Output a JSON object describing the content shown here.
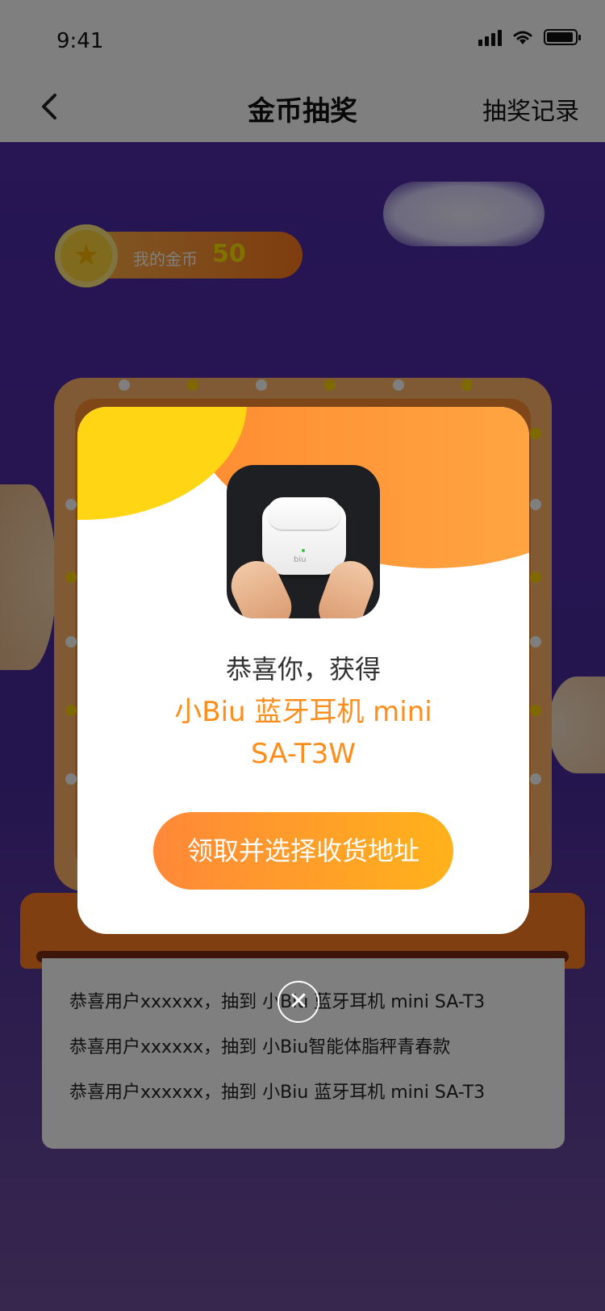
{
  "status": {
    "time": "9:41"
  },
  "nav": {
    "title": "金币抽奖",
    "right_label": "抽奖记录"
  },
  "coins": {
    "label": "我的金币",
    "value": "50"
  },
  "ticker": {
    "rows": [
      "恭喜用户xxxxxx，抽到 小Biu 蓝牙耳机 mini SA-T3",
      "恭喜用户xxxxxx，抽到 小Biu智能体脂秤青春款",
      "恭喜用户xxxxxx，抽到 小Biu 蓝牙耳机 mini SA-T3"
    ]
  },
  "modal": {
    "congrats": "恭喜你，获得",
    "prize_line1": "小Biu 蓝牙耳机 mini",
    "prize_line2": "SA-T3W",
    "claim_button": "领取并选择收货地址",
    "product_logo": "biu"
  },
  "icons": {
    "back": "chevron-left-icon",
    "close": "close-icon",
    "coin": "star-icon"
  },
  "colors": {
    "accent_orange": "#ff8d1a",
    "button_start": "#ff8838",
    "button_end": "#ffb21b",
    "coin_value": "#ffe400"
  }
}
